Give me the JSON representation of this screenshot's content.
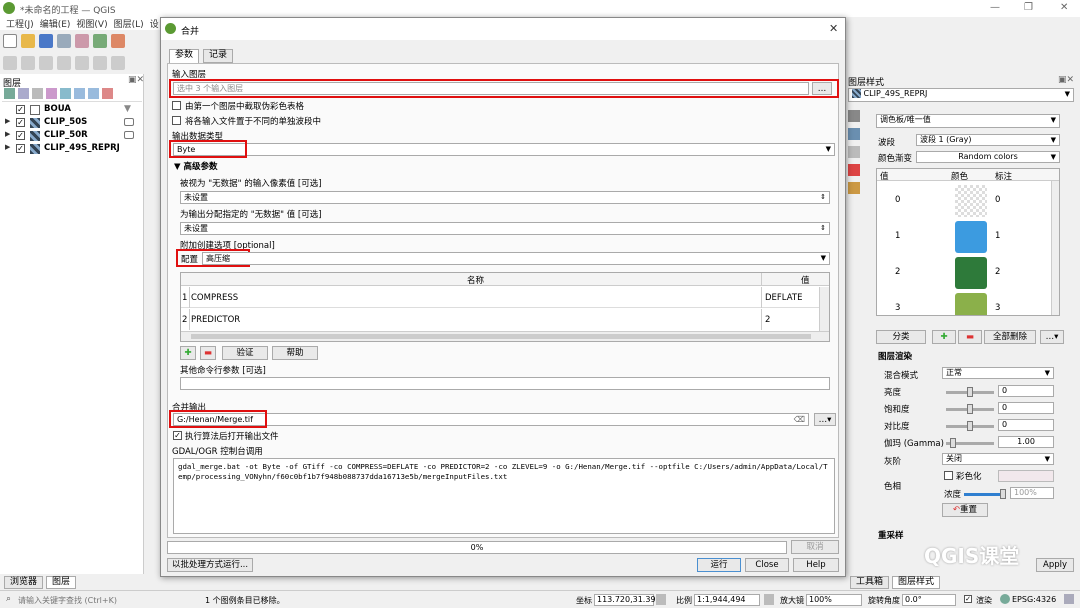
{
  "window": {
    "title": "*未命名的工程 — QGIS"
  },
  "menu": [
    "工程(J)",
    "编辑(E)",
    "视图(V)",
    "图层(L)",
    "设"
  ],
  "layers_panel": {
    "title": "图层",
    "layers": [
      {
        "name": "BOUA",
        "checked": true
      },
      {
        "name": "CLIP_50S",
        "checked": true
      },
      {
        "name": "CLIP_50R",
        "checked": true
      },
      {
        "name": "CLIP_49S_REPRJ",
        "checked": true
      }
    ]
  },
  "left_tabs": [
    "浏览器",
    "图层"
  ],
  "dialog": {
    "title": "合并",
    "tabs": [
      "参数",
      "记录"
    ],
    "input_layers_label": "输入图层",
    "input_layers_value": "选中 3 个输入图层",
    "browse_btn": "…",
    "pct_label": "由第一个图层中截取伪彩色表格",
    "separate_label": "将各输入文件置于不同的单独波段中",
    "output_type_label": "输出数据类型",
    "output_type_value": "Byte",
    "advanced_label": "高级参数",
    "nodata_in_label": "被视为 \"无数据\" 的输入像素值 [可选]",
    "nodata_in_value": "未设置",
    "nodata_out_label": "为输出分配指定的 \"无数据\" 值 [可选]",
    "nodata_out_value": "未设置",
    "options_label": "附加创建选项 [optional]",
    "profile_label": "配置",
    "profile_value": "高压缩",
    "table_headers": [
      "名称",
      "值"
    ],
    "table_rows": [
      {
        "idx": "1",
        "name": "COMPRESS",
        "value": "DEFLATE"
      },
      {
        "idx": "2",
        "name": "PREDICTOR",
        "value": "2"
      }
    ],
    "validate_btn": "验证",
    "help_small_btn": "帮助",
    "extra_label": "其他命令行参数 [可选]",
    "output_label": "合并输出",
    "output_value": "G:/Henan/Merge.tif",
    "open_after_label": "执行算法后打开输出文件",
    "console_label": "GDAL/OGR 控制台调用",
    "console_text": "gdal_merge.bat -ot Byte -of GTiff -co COMPRESS=DEFLATE -co PREDICTOR=2 -co ZLEVEL=9 -o G:/Henan/Merge.tif --optfile C:/Users/admin/AppData/Local/Temp/processing_VONyhn/f60c0bf1b7f948b088737dda16713e5b/mergeInputFiles.txt",
    "progress": "0%",
    "cancel_btn": "取消",
    "batch_btn": "以批处理方式运行...",
    "run_btn": "运行",
    "close_btn": "Close",
    "help_btn": "Help"
  },
  "style_panel": {
    "title": "图层样式",
    "layer": "CLIP_49S_REPRJ",
    "renderer": "调色板/唯一值",
    "band_label": "波段",
    "band_value": "波段 1 (Gray)",
    "ramp_label": "颜色渐变",
    "ramp_value": "Random colors",
    "table_headers": [
      "值",
      "颜色",
      "标注"
    ],
    "classes": [
      {
        "value": "0",
        "label": "0",
        "color": "#e8e8e8"
      },
      {
        "value": "1",
        "label": "1",
        "color": "#3c9be0"
      },
      {
        "value": "2",
        "label": "2",
        "color": "#2e7a3a"
      },
      {
        "value": "3",
        "label": "3",
        "color": "#8bb04a"
      }
    ],
    "classify_btn": "分类",
    "delete_all_btn": "全部删除",
    "rendering_title": "图层渲染",
    "blend_label": "混合模式",
    "blend_value": "正常",
    "brightness_label": "亮度",
    "brightness_value": "0",
    "saturation_label": "饱和度",
    "saturation_value": "0",
    "contrast_label": "对比度",
    "contrast_value": "0",
    "gamma_label": "伽玛 (Gamma)",
    "gamma_value": "1.00",
    "grayscale_label": "灰阶",
    "grayscale_value": "关闭",
    "hue_label": "色相",
    "colorize_label": "彩色化",
    "strength_label": "浓度",
    "strength_value": "100%",
    "reset_btn": "重置",
    "resample_label": "重采样",
    "apply_btn": "Apply",
    "tabs": [
      "工具箱",
      "图层样式"
    ]
  },
  "status": {
    "search_placeholder": "请输入关键字查找 (Ctrl+K)",
    "message": "1 个图例条目已移除。",
    "coord_label": "坐标",
    "coord_value": "113.720,31.392",
    "scale_label": "比例",
    "scale_value": "1:1,944,494",
    "magnifier_label": "放大镜",
    "magnifier_value": "100%",
    "rotation_label": "旋转角度",
    "rotation_value": "0.0°",
    "render_label": "渲染",
    "crs": "EPSG:4326"
  },
  "watermark": "QGIS课堂"
}
